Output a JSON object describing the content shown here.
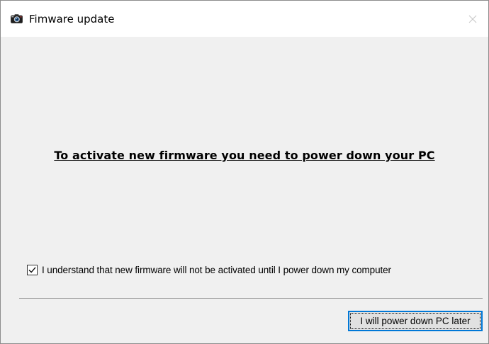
{
  "window": {
    "title": "Fimware update",
    "app_icon": "camera-icon",
    "close_icon": "close-icon"
  },
  "main": {
    "headline": "To activate new firmware you need to power down your PC",
    "checkbox": {
      "checked": true,
      "label": "I understand that new firmware will not be activated until I power down my computer"
    },
    "button_label": "I will power down PC later"
  },
  "colors": {
    "accent": "#0078d7",
    "dialog_background": "#f0f0f0",
    "titlebar_background": "#ffffff"
  }
}
